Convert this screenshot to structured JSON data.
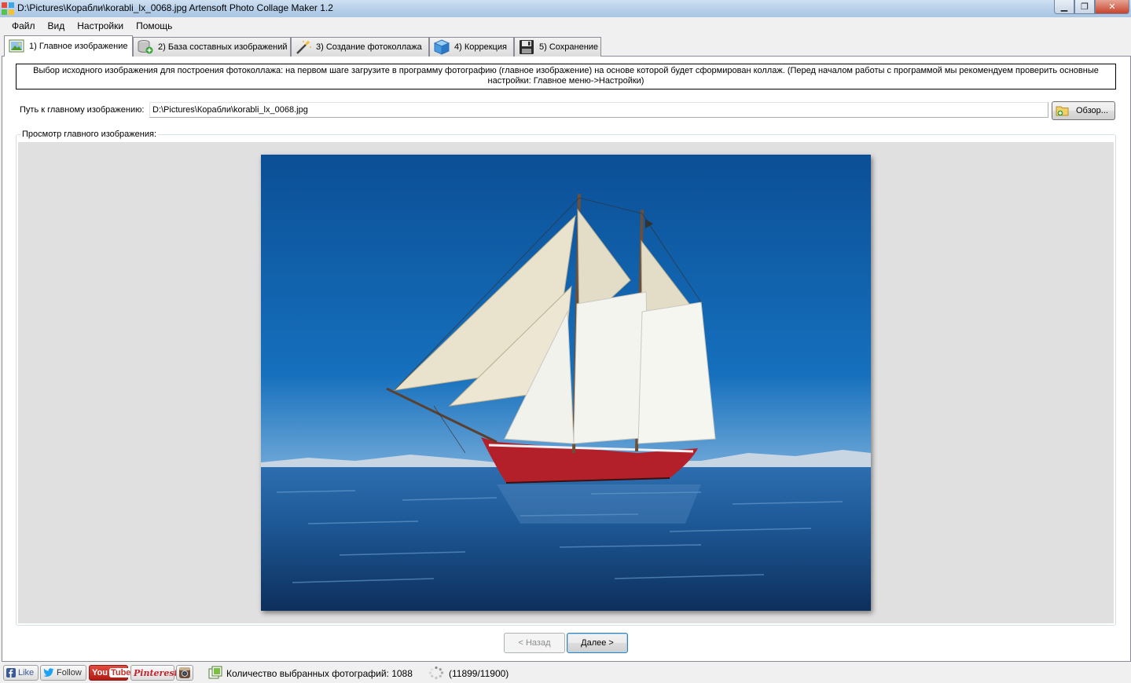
{
  "window": {
    "title": "D:\\Pictures\\Корабли\\korabli_lx_0068.jpg Artensoft Photo Collage Maker 1.2",
    "minimize": "▁",
    "maximize": "❐",
    "close": "✕"
  },
  "menu": {
    "items": [
      "Файл",
      "Вид",
      "Настройки",
      "Помощь"
    ]
  },
  "tabs": [
    {
      "label": "1) Главное изображение",
      "icon": "image-icon",
      "active": true
    },
    {
      "label": "2) База составных изображений",
      "icon": "database-add-icon",
      "active": false
    },
    {
      "label": "3) Создание фотоколлажа",
      "icon": "magic-wand-icon",
      "active": false
    },
    {
      "label": "4) Коррекция",
      "icon": "cube-icon",
      "active": false
    },
    {
      "label": "5) Сохранение",
      "icon": "floppy-disk-icon",
      "active": false
    }
  ],
  "main": {
    "description": "Выбор исходного изображения для построения фотоколлажа: на первом шаге загрузите в программу фотографию (главное изображение) на основе которой будет сформирован коллаж. (Перед началом работы с программой мы рекомендуем проверить основные настройки: Главное меню->Настройки)",
    "path_label": "Путь к главному изображению:",
    "path_value": "D:\\Pictures\\Корабли\\korabli_lx_0068.jpg",
    "browse_label": "Обзор...",
    "preview_label": "Просмотр главного изображения:",
    "back_label": "< Назад",
    "next_label": "Далее >"
  },
  "statusbar": {
    "like_label": "Like",
    "follow_label": "Follow",
    "youtube_you": "You",
    "youtube_tube": "Tube",
    "pinterest_label": "Pinterest",
    "photo_count": "Количество выбранных фотографий: 1088",
    "progress": "(11899/11900)"
  },
  "colors": {
    "sky": "#0e5da8",
    "sea": "#1a4f8a",
    "hull": "#b3202a",
    "sail": "#eeeee6"
  }
}
